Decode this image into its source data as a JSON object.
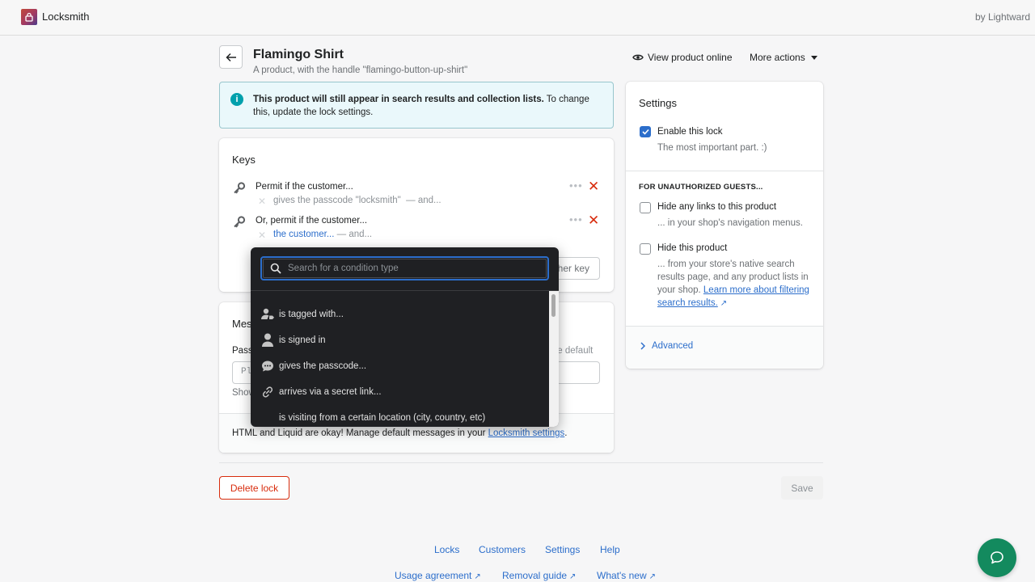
{
  "app": {
    "name": "Locksmith",
    "byline": "by Lightward"
  },
  "header": {
    "title": "Flamingo Shirt",
    "subtitle": "A product, with the handle \"flamingo-button-up-shirt\"",
    "view_online": "View product online",
    "more_actions": "More actions"
  },
  "banner": {
    "bold": "This product will still appear in search results and collection lists.",
    "rest": " To change this, update the lock settings."
  },
  "keys": {
    "title": "Keys",
    "items": [
      {
        "label": "Permit if the customer...",
        "condition": "gives the passcode \"locksmith\"",
        "and": "— and...",
        "condition_is_link": false
      },
      {
        "label": "Or, permit if the customer...",
        "condition": "the customer...",
        "and": "— and...",
        "condition_is_link": true
      }
    ],
    "add_key_partial": "her key"
  },
  "messages": {
    "title_partial": "Mes",
    "passcode_label_partial": "Pass",
    "restore_partial": "ore default",
    "input_partial": "Pl",
    "show_partial": "Show",
    "footer_text": "HTML and Liquid are okay! Manage default messages in your ",
    "footer_link": "Locksmith settings",
    "footer_end": "."
  },
  "dropdown": {
    "search_placeholder": "Search for a condition type",
    "search_value": "",
    "items": [
      {
        "icon": "customer-tag-icon",
        "label": "is tagged with..."
      },
      {
        "icon": "customer-icon",
        "label": "is signed in"
      },
      {
        "icon": "chat-bubble-icon",
        "label": "gives the passcode..."
      },
      {
        "icon": "link-icon",
        "label": "arrives via a secret link..."
      },
      {
        "icon": "",
        "label": "is visiting from a certain location (city, country, etc)"
      }
    ]
  },
  "settings": {
    "title": "Settings",
    "enable_label": "Enable this lock",
    "enable_checked": true,
    "enable_help": "The most important part. :)",
    "guests_heading": "FOR UNAUTHORIZED GUESTS...",
    "hide_links_label": "Hide any links to this product",
    "hide_links_checked": false,
    "hide_links_help": "... in your shop's navigation menus.",
    "hide_product_label": "Hide this product",
    "hide_product_checked": false,
    "hide_product_help": "... from your store's native search results page, and any product lists in your shop. ",
    "hide_product_link": "Learn more about filtering search results.",
    "advanced": "Advanced"
  },
  "actions": {
    "delete": "Delete lock",
    "save": "Save"
  },
  "footer": {
    "nav": [
      "Locks",
      "Customers",
      "Settings",
      "Help"
    ],
    "external": [
      "Usage agreement",
      "Removal guide",
      "What's new"
    ]
  },
  "colors": {
    "accent": "#2c6ecb",
    "danger": "#d82c0d",
    "info": "#00a0ac",
    "chat": "#138a5e"
  }
}
